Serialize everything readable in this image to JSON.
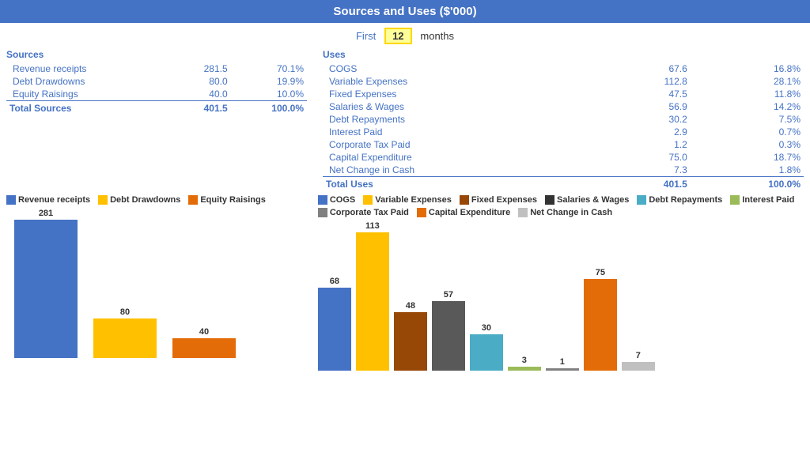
{
  "header": {
    "title": "Sources and Uses ($'000)",
    "months_prefix": "First",
    "months_value": "12",
    "months_suffix": "months"
  },
  "sources": {
    "section_label": "Sources",
    "items": [
      {
        "label": "Revenue receipts",
        "amount": "281.5",
        "pct": "70.1%"
      },
      {
        "label": "Debt Drawdowns",
        "amount": "80.0",
        "pct": "19.9%"
      },
      {
        "label": "Equity Raisings",
        "amount": "40.0",
        "pct": "10.0%"
      }
    ],
    "total_label": "Total Sources",
    "total_amount": "401.5",
    "total_pct": "100.0%"
  },
  "uses": {
    "section_label": "Uses",
    "items": [
      {
        "label": "COGS",
        "amount": "67.6",
        "pct": "16.8%"
      },
      {
        "label": "Variable Expenses",
        "amount": "112.8",
        "pct": "28.1%"
      },
      {
        "label": "Fixed Expenses",
        "amount": "47.5",
        "pct": "11.8%"
      },
      {
        "label": "Salaries & Wages",
        "amount": "56.9",
        "pct": "14.2%"
      },
      {
        "label": "Debt Repayments",
        "amount": "30.2",
        "pct": "7.5%"
      },
      {
        "label": "Interest Paid",
        "amount": "2.9",
        "pct": "0.7%"
      },
      {
        "label": "Corporate Tax Paid",
        "amount": "1.2",
        "pct": "0.3%"
      },
      {
        "label": "Capital Expenditure",
        "amount": "75.0",
        "pct": "18.7%"
      },
      {
        "label": "Net Change in Cash",
        "amount": "7.3",
        "pct": "1.8%"
      }
    ],
    "total_label": "Total Uses",
    "total_amount": "401.5",
    "total_pct": "100.0%"
  },
  "left_chart": {
    "legend": [
      {
        "label": "Revenue receipts",
        "color": "#4472C4"
      },
      {
        "label": "Debt Drawdowns",
        "color": "#FFC000"
      },
      {
        "label": "Equity Raisings",
        "color": "#E36C09"
      }
    ],
    "bars": [
      {
        "label": "281",
        "value": 281,
        "color": "#4472C4",
        "width": 80
      },
      {
        "label": "80",
        "value": 80,
        "color": "#FFC000",
        "width": 80
      },
      {
        "label": "40",
        "value": 40,
        "color": "#E36C09",
        "width": 80
      }
    ],
    "max": 281
  },
  "right_chart": {
    "legend": [
      {
        "label": "COGS",
        "color": "#4472C4"
      },
      {
        "label": "Variable Expenses",
        "color": "#FFC000"
      },
      {
        "label": "Fixed Expenses",
        "color": "#974706"
      },
      {
        "label": "Salaries & Wages",
        "color": "#333333"
      },
      {
        "label": "Debt Repayments",
        "color": "#4BACC6"
      },
      {
        "label": "Interest Paid",
        "color": "#9BBB59"
      },
      {
        "label": "Corporate Tax Paid",
        "color": "#808080"
      },
      {
        "label": "Capital Expenditure",
        "color": "#E36C09"
      },
      {
        "label": "Net Change in Cash",
        "color": "#C0C0C0"
      }
    ],
    "bars": [
      {
        "label": "68",
        "value": 68,
        "color": "#4472C4",
        "width": 42
      },
      {
        "label": "113",
        "value": 113,
        "color": "#FFC000",
        "width": 42
      },
      {
        "label": "48",
        "value": 48,
        "color": "#974706",
        "width": 42
      },
      {
        "label": "57",
        "value": 57,
        "color": "#595959",
        "width": 42
      },
      {
        "label": "30",
        "value": 30,
        "color": "#4BACC6",
        "width": 42
      },
      {
        "label": "3",
        "value": 3,
        "color": "#9BBB59",
        "width": 42
      },
      {
        "label": "1",
        "value": 1,
        "color": "#808080",
        "width": 42
      },
      {
        "label": "75",
        "value": 75,
        "color": "#E36C09",
        "width": 42
      },
      {
        "label": "7",
        "value": 7,
        "color": "#C0C0C0",
        "width": 42
      }
    ],
    "max": 113
  }
}
